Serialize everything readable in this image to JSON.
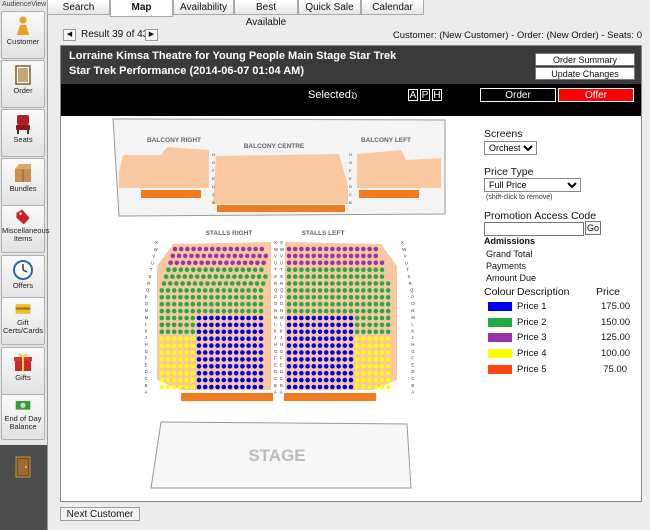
{
  "app": {
    "label": "AudienceView"
  },
  "sidebar": {
    "items": [
      {
        "label": "Customer",
        "icon": "person-icon"
      },
      {
        "label": "Order",
        "icon": "order-icon"
      },
      {
        "label": "Seats",
        "icon": "seat-icon"
      },
      {
        "label": "Bundles",
        "icon": "box-icon"
      },
      {
        "label": "Miscellaneous Items",
        "icon": "tag-icon"
      },
      {
        "label": "Offers",
        "icon": "clock-icon"
      },
      {
        "label": "Gift Certs/Cards",
        "icon": "gift-card-icon"
      },
      {
        "label": "Gifts",
        "icon": "gift-icon"
      },
      {
        "label": "End of Day Balance",
        "icon": "money-icon"
      }
    ],
    "exit_icon": "exit-door-icon"
  },
  "tabs": [
    "Search",
    "Map",
    "Availability",
    "Best Available",
    "Quick Sale",
    "Calendar"
  ],
  "active_tab": "Map",
  "result_nav": {
    "text": "Result 39 of 43"
  },
  "status_line": "Customer: (New Customer) - Order: (New Order) - Seats: 0",
  "header": {
    "title_line1": "Lorraine Kimsa Theatre for Young People Main Stage Star Trek",
    "title_line2": "Star Trek Performance  (2014-06-07 01:04 AM)",
    "order_summary": "Order Summary",
    "update_changes": "Update Changes"
  },
  "selection": {
    "label": "Selected:",
    "count": "0",
    "letters": [
      "A",
      "P",
      "H"
    ]
  },
  "actions": {
    "order": "Order",
    "offer": "Offer"
  },
  "map": {
    "balcony_right": "BALCONY RIGHT",
    "balcony_centre": "BALCONY CENTRE",
    "balcony_left": "BALCONY LEFT",
    "stalls_right": "STALLS RIGHT",
    "stalls_left": "STALLS LEFT",
    "stage": "STAGE"
  },
  "controls": {
    "screens_label": "Screens",
    "screens_value": "Orchestra",
    "price_type_label": "Price Type",
    "price_type_value": "Full Price",
    "price_hint": "(shift-click to remove)",
    "promo_label": "Promotion Access Code",
    "promo_value": "",
    "go_label": "Go"
  },
  "admissions": {
    "heading": "Admissions",
    "rows": [
      "Grand Total",
      "Payments",
      "Amount Due"
    ]
  },
  "legend": {
    "col_colour": "Colour",
    "col_description": "Description",
    "col_price": "Price",
    "rows": [
      {
        "desc": "Price 1",
        "price": "175.00",
        "color": "#0000ee"
      },
      {
        "desc": "Price 2",
        "price": "150.00",
        "color": "#22aa44"
      },
      {
        "desc": "Price 3",
        "price": "125.00",
        "color": "#9933aa"
      },
      {
        "desc": "Price 4",
        "price": "100.00",
        "color": "#ffff00"
      },
      {
        "desc": "Price 5",
        "price": "75.00",
        "color": "#ff4411"
      }
    ]
  },
  "footer": {
    "next_customer": "Next Customer"
  }
}
